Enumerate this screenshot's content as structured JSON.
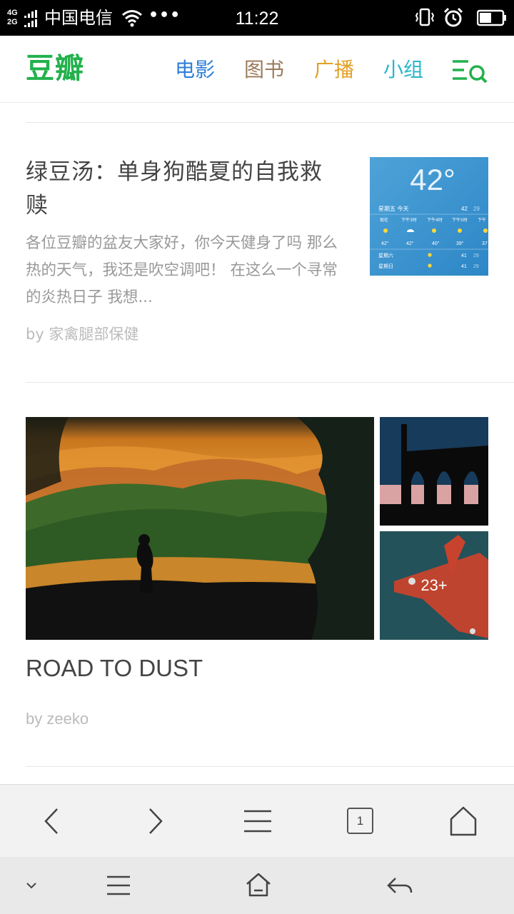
{
  "status_bar": {
    "network_top": "4G",
    "network_bottom": "2G",
    "carrier": "中国电信",
    "more_dots": "•••",
    "time": "11:22"
  },
  "header": {
    "logo": "豆瓣",
    "nav": [
      {
        "label": "电影",
        "color": "#2e7fd6"
      },
      {
        "label": "图书",
        "color": "#9b7a5b"
      },
      {
        "label": "广播",
        "color": "#e2a026"
      },
      {
        "label": "小组",
        "color": "#2ab7c9"
      }
    ],
    "brand_color": "#22b14c"
  },
  "feed": {
    "items": [
      {
        "title": "绿豆汤：单身狗酷夏的自我救赎",
        "excerpt": "各位豆瓣的盆友大家好，你今天健身了吗 那么热的天气，我还是吹空调吧！ 在这么一个寻常的炎热日子 我想...",
        "byline": "by 家禽腿部保健",
        "thumbnail": {
          "temperature": "42°",
          "row_label": "星期五 今天",
          "hi": "42",
          "lo": "29",
          "hours": [
            "现在",
            "下午3时",
            "下午4时",
            "下午5时",
            "下午"
          ],
          "hour_temps": [
            "42°",
            "42°",
            "40°",
            "39°",
            "37"
          ],
          "days": [
            {
              "day": "星期六",
              "hi": "41",
              "lo": "29"
            },
            {
              "day": "星期日",
              "hi": "41",
              "lo": "29"
            }
          ]
        }
      },
      {
        "title": "ROAD TO DUST",
        "byline": "by zeeko",
        "more_images": "23+"
      }
    ]
  },
  "browser_toolbar": {
    "tab_count": "1"
  }
}
